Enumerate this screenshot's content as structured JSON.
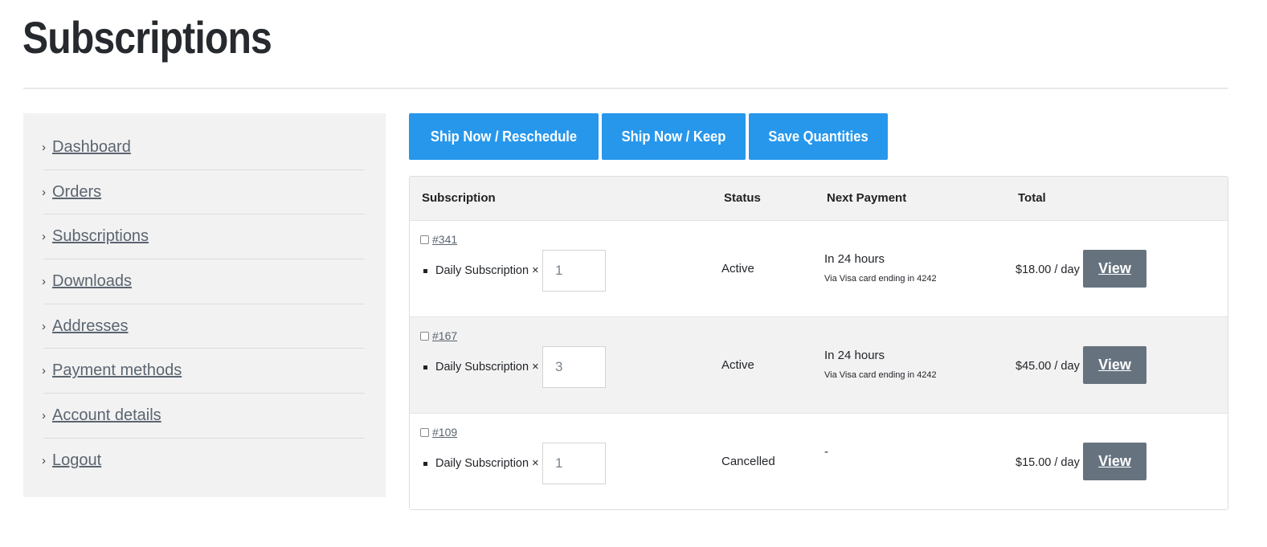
{
  "page": {
    "title": "Subscriptions"
  },
  "sidebar": {
    "items": [
      {
        "label": "Dashboard"
      },
      {
        "label": "Orders"
      },
      {
        "label": "Subscriptions"
      },
      {
        "label": "Downloads"
      },
      {
        "label": "Addresses"
      },
      {
        "label": "Payment methods"
      },
      {
        "label": "Account details"
      },
      {
        "label": "Logout"
      }
    ],
    "chevron": "›"
  },
  "toolbar": {
    "ship_reschedule": "Ship Now / Reschedule",
    "ship_keep": "Ship Now / Keep",
    "save_quantities": "Save Quantities"
  },
  "table": {
    "headers": {
      "subscription": "Subscription",
      "status": "Status",
      "next_payment": "Next Payment",
      "total": "Total"
    },
    "rows": [
      {
        "number": "#341",
        "item": "Daily Subscription ×",
        "quantity": "1",
        "status": "Active",
        "next_payment": "In 24 hours",
        "payment_method": "Via Visa card ending in 4242",
        "total": "$18.00 / day",
        "action": "View"
      },
      {
        "number": "#167",
        "item": "Daily Subscription ×",
        "quantity": "3",
        "status": "Active",
        "next_payment": "In 24 hours",
        "payment_method": "Via Visa card ending in 4242",
        "total": "$45.00 / day",
        "action": "View"
      },
      {
        "number": "#109",
        "item": "Daily Subscription ×",
        "quantity": "1",
        "status": "Cancelled",
        "next_payment": "-",
        "payment_method": "",
        "total": "$15.00 / day",
        "action": "View"
      }
    ]
  },
  "colors": {
    "primary_button": "#2797ec",
    "view_button": "#66737f",
    "sidebar_bg": "#f2f2f2",
    "link": "#5b6570"
  }
}
